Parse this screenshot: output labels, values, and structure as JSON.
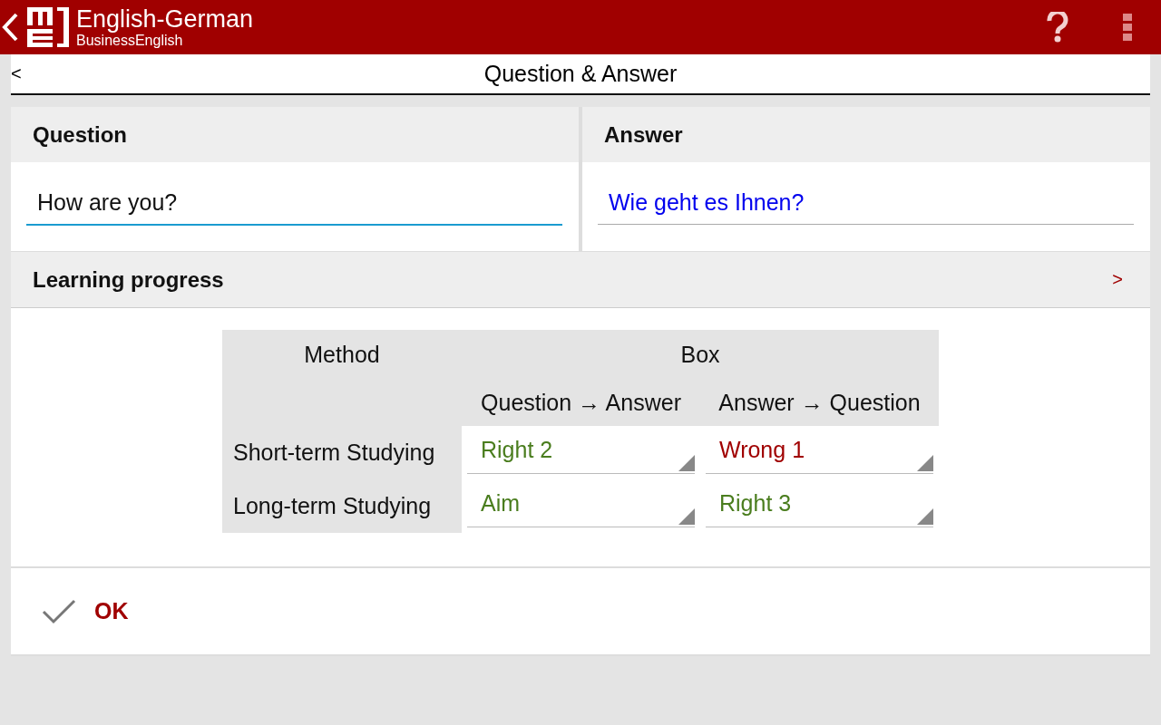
{
  "app_bar": {
    "title": "English-German",
    "subtitle": "BusinessEnglish"
  },
  "subheader": {
    "back": "<",
    "title": "Question & Answer"
  },
  "question": {
    "label": "Question",
    "value": "How are you?",
    "focused": true
  },
  "answer": {
    "label": "Answer",
    "value": "Wie geht es Ihnen?",
    "focused": false
  },
  "progress": {
    "title": "Learning progress",
    "toggle": ">",
    "table": {
      "method_heading": "Method",
      "box_heading": "Box",
      "directions": [
        "Question → Answer",
        "Answer → Question"
      ],
      "rows": [
        {
          "method": "Short-term Studying",
          "boxes": [
            {
              "value": "Right 2",
              "color": "#4a7d1e"
            },
            {
              "value": "Wrong 1",
              "color": "#a00000"
            }
          ]
        },
        {
          "method": "Long-term Studying",
          "boxes": [
            {
              "value": "Aim",
              "color": "#4a7d1e"
            },
            {
              "value": "Right 3",
              "color": "#4a7d1e"
            }
          ]
        }
      ]
    }
  },
  "ok_button": {
    "label": "OK"
  }
}
